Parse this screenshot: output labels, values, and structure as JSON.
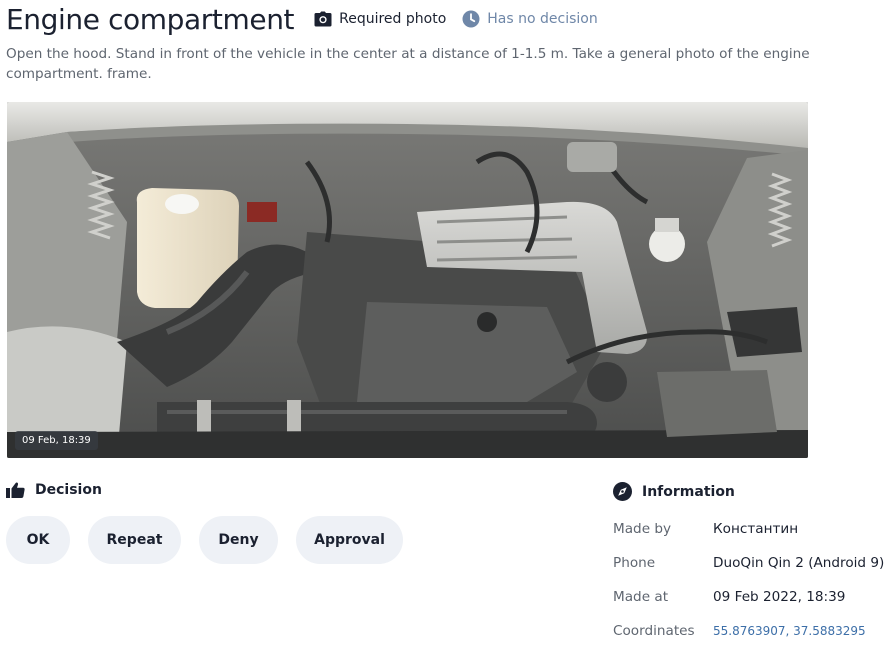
{
  "header": {
    "title": "Engine compartment",
    "required_label": "Required photo",
    "status_label": "Has no decision"
  },
  "description": "Open the hood. Stand in front of the vehicle in the center at a distance of 1-1.5 m. Take a general photo of the engine compartment. frame.",
  "photo": {
    "timestamp": "09 Feb, 18:39"
  },
  "decision": {
    "heading": "Decision",
    "buttons": [
      "OK",
      "Repeat",
      "Deny",
      "Approval"
    ]
  },
  "information": {
    "heading": "Information",
    "rows": [
      {
        "label": "Made by",
        "value": "Константин"
      },
      {
        "label": "Phone",
        "value": "DuoQin Qin 2 (Android 9)"
      },
      {
        "label": "Made at",
        "value": "09 Feb 2022, 18:39"
      },
      {
        "label": "Coordinates",
        "value": "55.8763907, 37.5883295"
      }
    ]
  },
  "colors": {
    "status": "#6f87a8",
    "link": "#3d6fa8",
    "button_bg": "#eef1f6"
  }
}
